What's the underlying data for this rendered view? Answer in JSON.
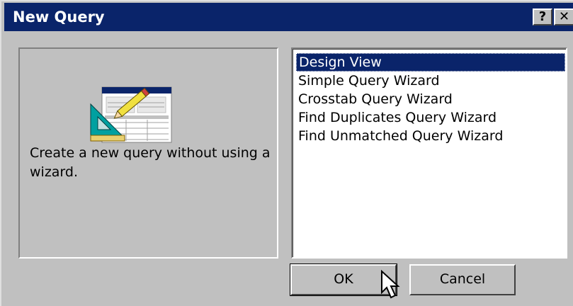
{
  "window": {
    "title": "New Query",
    "help_label": "?",
    "close_label": "✕"
  },
  "description": {
    "text": "Create a new query without using a wizard.",
    "icon": "query-design-icon"
  },
  "query_types": {
    "items": [
      {
        "label": "Design View",
        "selected": true
      },
      {
        "label": "Simple Query Wizard",
        "selected": false
      },
      {
        "label": "Crosstab Query Wizard",
        "selected": false
      },
      {
        "label": "Find Duplicates Query Wizard",
        "selected": false
      },
      {
        "label": "Find Unmatched Query Wizard",
        "selected": false
      }
    ]
  },
  "buttons": {
    "ok_label": "OK",
    "cancel_label": "Cancel"
  },
  "colors": {
    "title_bar": "#0a246a",
    "dialog_face": "#c0c0c0",
    "selection": "#0a246a"
  }
}
